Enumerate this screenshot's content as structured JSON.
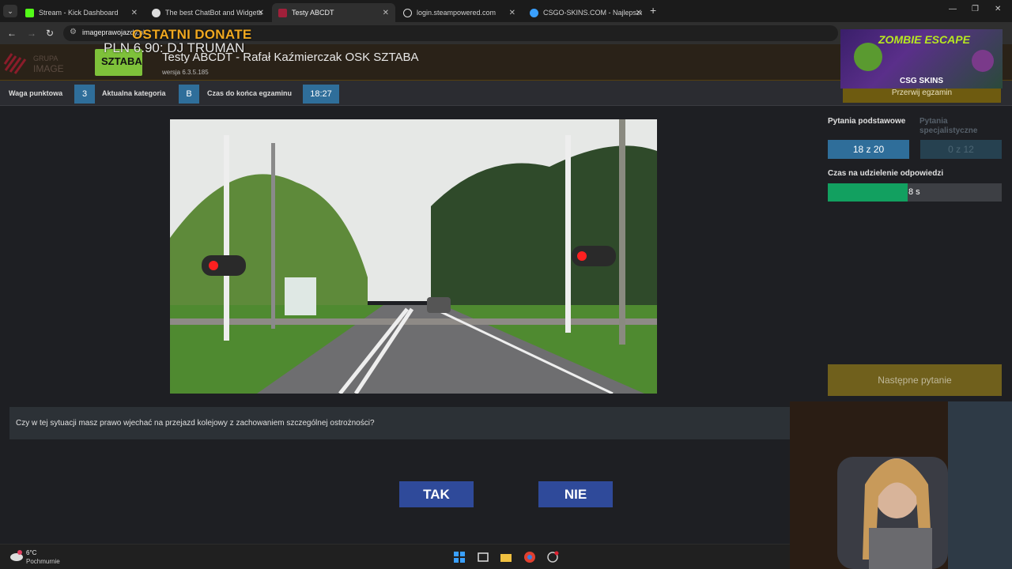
{
  "browser": {
    "tabs": [
      {
        "title": "Stream - Kick Dashboard",
        "favicon_color": "#53fc18"
      },
      {
        "title": "The best ChatBot and Widgets",
        "favicon_color": "#dddddd"
      },
      {
        "title": "Testy ABCDT",
        "favicon_color": "#a0203a"
      },
      {
        "title": "login.steampowered.com",
        "favicon_color": "#dddddd"
      },
      {
        "title": "CSGO-SKINS.COM - Najlepsze",
        "favicon_color": "#3aa0ff"
      }
    ],
    "url": "imageprawojazdy.pl"
  },
  "overlay": {
    "donate_title": "OSTATNI DONATE",
    "donate_amount": "PLN 6.90: DJ TRUMAN",
    "ad_title": "ZOMBIE ESCAPE",
    "ad_brand": "CSG SKINS"
  },
  "header": {
    "title": "Testy ABCDT - Rafał Kaźmierczak OSK SZTABA",
    "version": "wersja 6.3.5.185",
    "logo_text": "SZTABA",
    "grupa_logo_text": "GRUPA IMAGE"
  },
  "stats": {
    "weight_label": "Waga punktowa",
    "weight_value": "3",
    "category_label": "Aktualna kategoria",
    "category_value": "B",
    "time_label": "Czas do końca egzaminu",
    "time_value": "18:27"
  },
  "abort_button": "Przerwij egzamin",
  "question": "Czy w tej sytuacji masz prawo wjechać na przejazd kolejowy z zachowaniem szczególnej ostrożności?",
  "answers": {
    "yes": "TAK",
    "no": "NIE"
  },
  "panel": {
    "basic_label": "Pytania podstawowe",
    "basic_count": "18 z 20",
    "special_label": "Pytania specjalistyczne",
    "special_count": "0 z 12",
    "answer_time_label": "Czas na udzielenie odpowiedzi",
    "answer_time_value": "8 s",
    "answer_time_fraction": 0.46,
    "next_button": "Następne pytanie"
  },
  "taskbar": {
    "temperature": "6°C",
    "weather": "Pochmurnie"
  },
  "colors": {
    "accent_blue": "#2f6e9a",
    "answer_blue": "#2f4a9a",
    "progress_green": "#12a060",
    "gold": "#70601c"
  }
}
